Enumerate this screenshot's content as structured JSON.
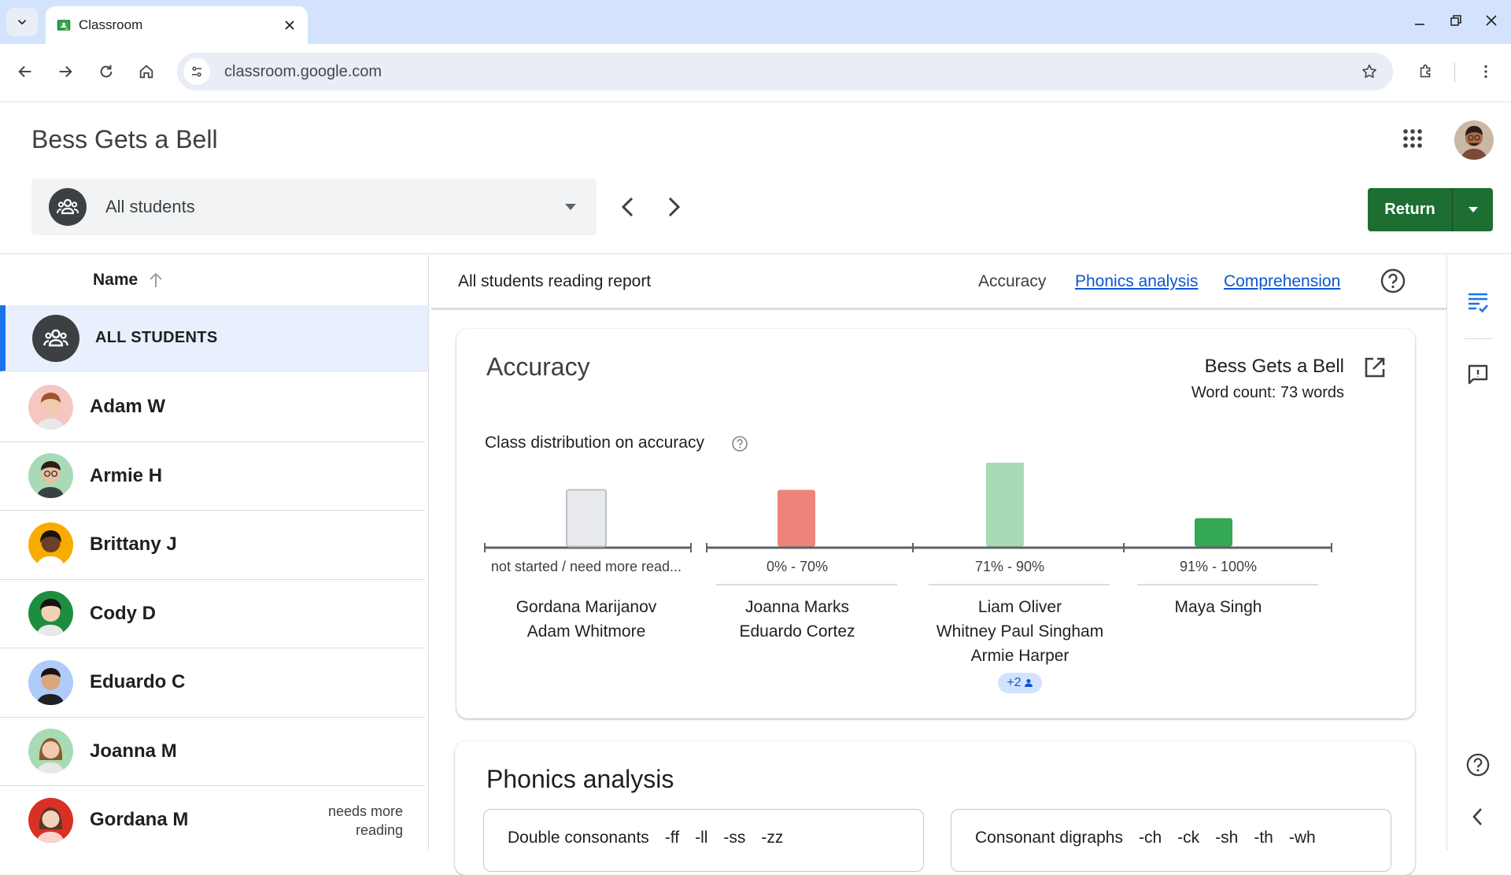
{
  "browser": {
    "tab_title": "Classroom",
    "url": "classroom.google.com"
  },
  "header": {
    "title": "Bess Gets a Bell",
    "student_selector": "All students",
    "return_label": "Return"
  },
  "list": {
    "name_header": "Name",
    "all_students_label": "ALL STUDENTS",
    "students": [
      {
        "name": "Adam W",
        "note": ""
      },
      {
        "name": "Armie H",
        "note": ""
      },
      {
        "name": "Brittany J",
        "note": ""
      },
      {
        "name": "Cody D",
        "note": ""
      },
      {
        "name": "Eduardo C",
        "note": ""
      },
      {
        "name": "Joanna M",
        "note": ""
      },
      {
        "name": "Gordana M",
        "note": "needs more reading"
      }
    ]
  },
  "report": {
    "title": "All students reading report",
    "tabs": [
      "Accuracy",
      "Phonics analysis",
      "Comprehension"
    ]
  },
  "accuracy": {
    "title": "Accuracy",
    "story_title": "Bess Gets a Bell",
    "word_count": "Word count: 73 words",
    "distribution_title": "Class distribution on accuracy",
    "more_chip": "+2",
    "buckets": [
      {
        "label": "not started / need more read...",
        "names": [
          "Gordana Marijanov",
          "Adam Whitmore"
        ]
      },
      {
        "label": "0% - 70%",
        "names": [
          "Joanna Marks",
          "Eduardo Cortez"
        ]
      },
      {
        "label": "71% - 90%",
        "names": [
          "Liam Oliver",
          "Whitney Paul Singham",
          "Armie Harper"
        ]
      },
      {
        "label": "91% - 100%",
        "names": [
          "Maya Singh"
        ]
      }
    ]
  },
  "chart_data": {
    "type": "bar",
    "categories": [
      "not started / need more read...",
      "0% - 70%",
      "71% - 90%",
      "91% - 100%"
    ],
    "values": [
      2,
      2,
      3,
      1
    ],
    "colors": [
      "#e8eaed",
      "#ee8479",
      "#a8dab5",
      "#34a853"
    ],
    "title": "Class distribution on accuracy"
  },
  "phonics": {
    "title": "Phonics analysis",
    "boxes": [
      {
        "label": "Double consonants",
        "items": [
          "-ff",
          "-ll",
          "-ss",
          "-zz"
        ]
      },
      {
        "label": "Consonant digraphs",
        "items": [
          "-ch",
          "-ck",
          "-sh",
          "-th",
          "-wh"
        ]
      }
    ]
  },
  "colors": {
    "accent_blue": "#1a73e8",
    "link_blue": "#0b57d0",
    "return_green": "#1e6e34"
  }
}
